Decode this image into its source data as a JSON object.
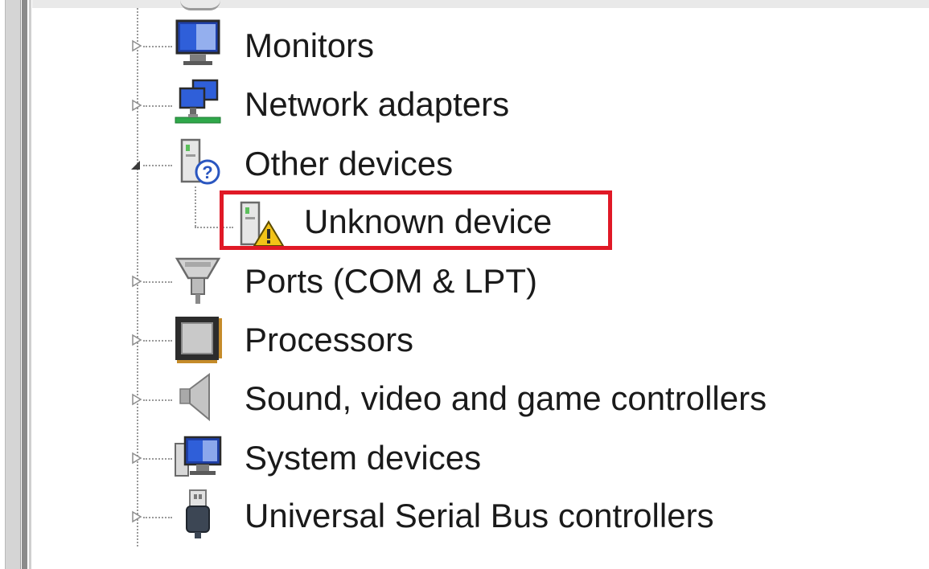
{
  "tree": {
    "items": [
      {
        "label": "Monitors",
        "expanded": false,
        "icon": "monitor-icon"
      },
      {
        "label": "Network adapters",
        "expanded": false,
        "icon": "network-adapter-icon"
      },
      {
        "label": "Other devices",
        "expanded": true,
        "icon": "unknown-category-icon"
      },
      {
        "label": "Unknown device",
        "child": true,
        "icon": "warning-device-icon"
      },
      {
        "label": "Ports (COM & LPT)",
        "expanded": false,
        "icon": "port-icon"
      },
      {
        "label": "Processors",
        "expanded": false,
        "icon": "processor-icon"
      },
      {
        "label": "Sound, video and game controllers",
        "expanded": false,
        "icon": "speaker-icon"
      },
      {
        "label": "System devices",
        "expanded": false,
        "icon": "system-device-icon"
      },
      {
        "label": "Universal Serial Bus controllers",
        "expanded": false,
        "icon": "usb-icon"
      }
    ]
  },
  "colors": {
    "highlight": "#e01926",
    "text": "#1a1a1a"
  }
}
